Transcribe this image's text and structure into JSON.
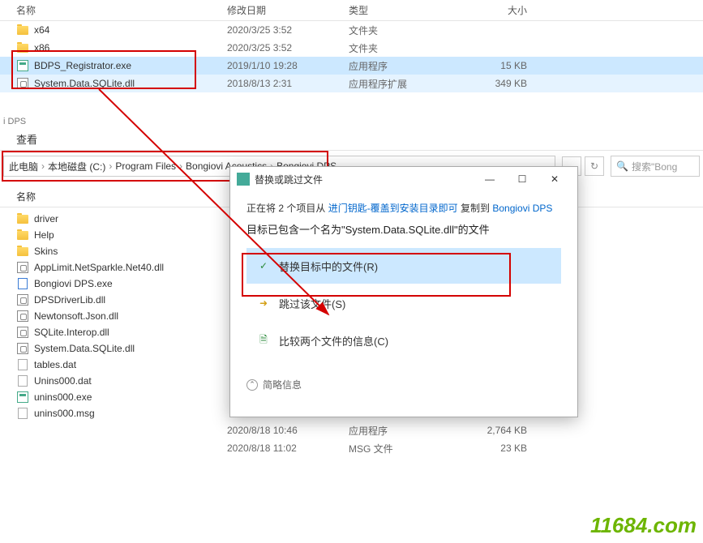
{
  "topHeader": {
    "name": "名称",
    "date": "修改日期",
    "type": "类型",
    "size": "大小"
  },
  "topFiles": [
    {
      "name": "x64",
      "date": "2020/3/25 3:52",
      "type": "文件夹",
      "size": "",
      "icon": "folder"
    },
    {
      "name": "x86",
      "date": "2020/3/25 3:52",
      "type": "文件夹",
      "size": "",
      "icon": "folder"
    },
    {
      "name": "BDPS_Registrator.exe",
      "date": "2019/1/10 19:28",
      "type": "应用程序",
      "size": "15 KB",
      "icon": "exe",
      "sel": "sel1"
    },
    {
      "name": "System.Data.SQLite.dll",
      "date": "2018/8/13 2:31",
      "type": "应用程序扩展",
      "size": "349 KB",
      "icon": "dll",
      "sel": "sel2"
    }
  ],
  "dpsLabel": "i DPS",
  "viewLabel": "查看",
  "breadcrumb": {
    "root": "此电脑",
    "c": "本地磁盘 (C:)",
    "pf": "Program Files",
    "ba": "Bongiovi Acoustics",
    "bd": "Bongiovi DPS"
  },
  "search": {
    "placeholder": "搜索\"Bong"
  },
  "lowerHeader": {
    "name": "名称"
  },
  "lowerFiles": [
    {
      "name": "driver",
      "icon": "folder"
    },
    {
      "name": "Help",
      "icon": "folder"
    },
    {
      "name": "Skins",
      "icon": "folder"
    },
    {
      "name": "AppLimit.NetSparkle.Net40.dll",
      "icon": "dll"
    },
    {
      "name": "Bongiovi DPS.exe",
      "icon": "file-blue"
    },
    {
      "name": "DPSDriverLib.dll",
      "icon": "dll"
    },
    {
      "name": "Newtonsoft.Json.dll",
      "icon": "dll"
    },
    {
      "name": "SQLite.Interop.dll",
      "icon": "dll"
    },
    {
      "name": "System.Data.SQLite.dll",
      "icon": "dll"
    },
    {
      "name": "tables.dat",
      "icon": "dat"
    },
    {
      "name": "Unins000.dat",
      "icon": "dat"
    },
    {
      "name": "unins000.exe",
      "icon": "exe"
    },
    {
      "name": "unins000.msg",
      "icon": "file"
    }
  ],
  "extraRows": [
    {
      "name": "",
      "date": "2020/8/18 10:46",
      "type": "应用程序",
      "size": "2,764 KB"
    },
    {
      "name": "",
      "date": "2020/8/18 11:02",
      "type": "MSG 文件",
      "size": "23 KB"
    }
  ],
  "dialog": {
    "title": "替换或跳过文件",
    "copyPrefix": "正在将 2 个项目从 ",
    "copySource": "进门钥匙-覆盖到安装目录即可",
    "copyMid": " 复制到 ",
    "copyDest": "Bongiovi DPS",
    "conflict": "目标已包含一个名为\"System.Data.SQLite.dll\"的文件",
    "opt1": "替换目标中的文件(R)",
    "opt2": "跳过该文件(S)",
    "opt3": "比较两个文件的信息(C)",
    "moreInfo": "简略信息"
  },
  "watermark": "11684.com"
}
